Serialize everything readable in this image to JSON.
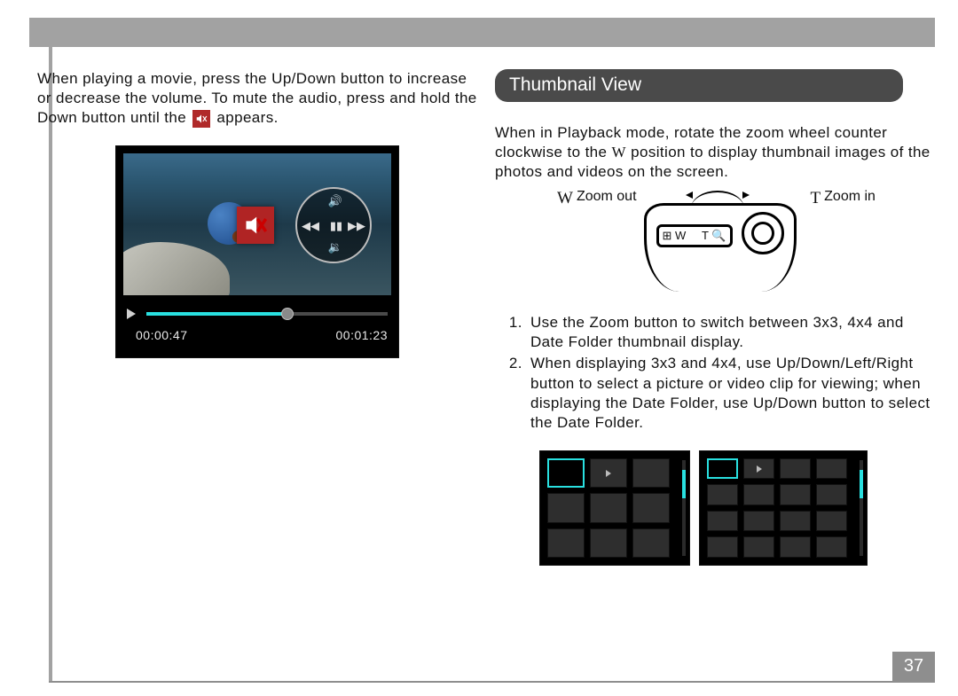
{
  "page_number": "37",
  "left": {
    "para1_pre": "When playing a movie, press the Up/Down button to increase or decrease the volume. To mute the audio, press and hold the Down button until the ",
    "para1_post": " appears.",
    "lcd": {
      "current_time": "00:00:47",
      "total_time": "00:01:23"
    }
  },
  "right": {
    "section_title": "Thumbnail View",
    "intro_pre": "When in Playback mode, rotate the zoom wheel counter clockwise to the ",
    "intro_w": "W",
    "intro_post": " position to display thumbnail images of the photos and videos on the screen.",
    "zoom_w": "W",
    "zoom_out": "Zoom out",
    "zoom_t": "T",
    "zoom_in": "Zoom in",
    "camtop_left": "⊞ W",
    "camtop_right": "T 🔍",
    "steps": [
      "Use the Zoom button to switch between 3x3, 4x4 and Date Folder thumbnail display.",
      "When displaying 3x3 and 4x4, use Up/Down/Left/Right button to select a picture or video clip for viewing; when displaying the Date Folder, use Up/Down button to select the Date Folder."
    ]
  }
}
